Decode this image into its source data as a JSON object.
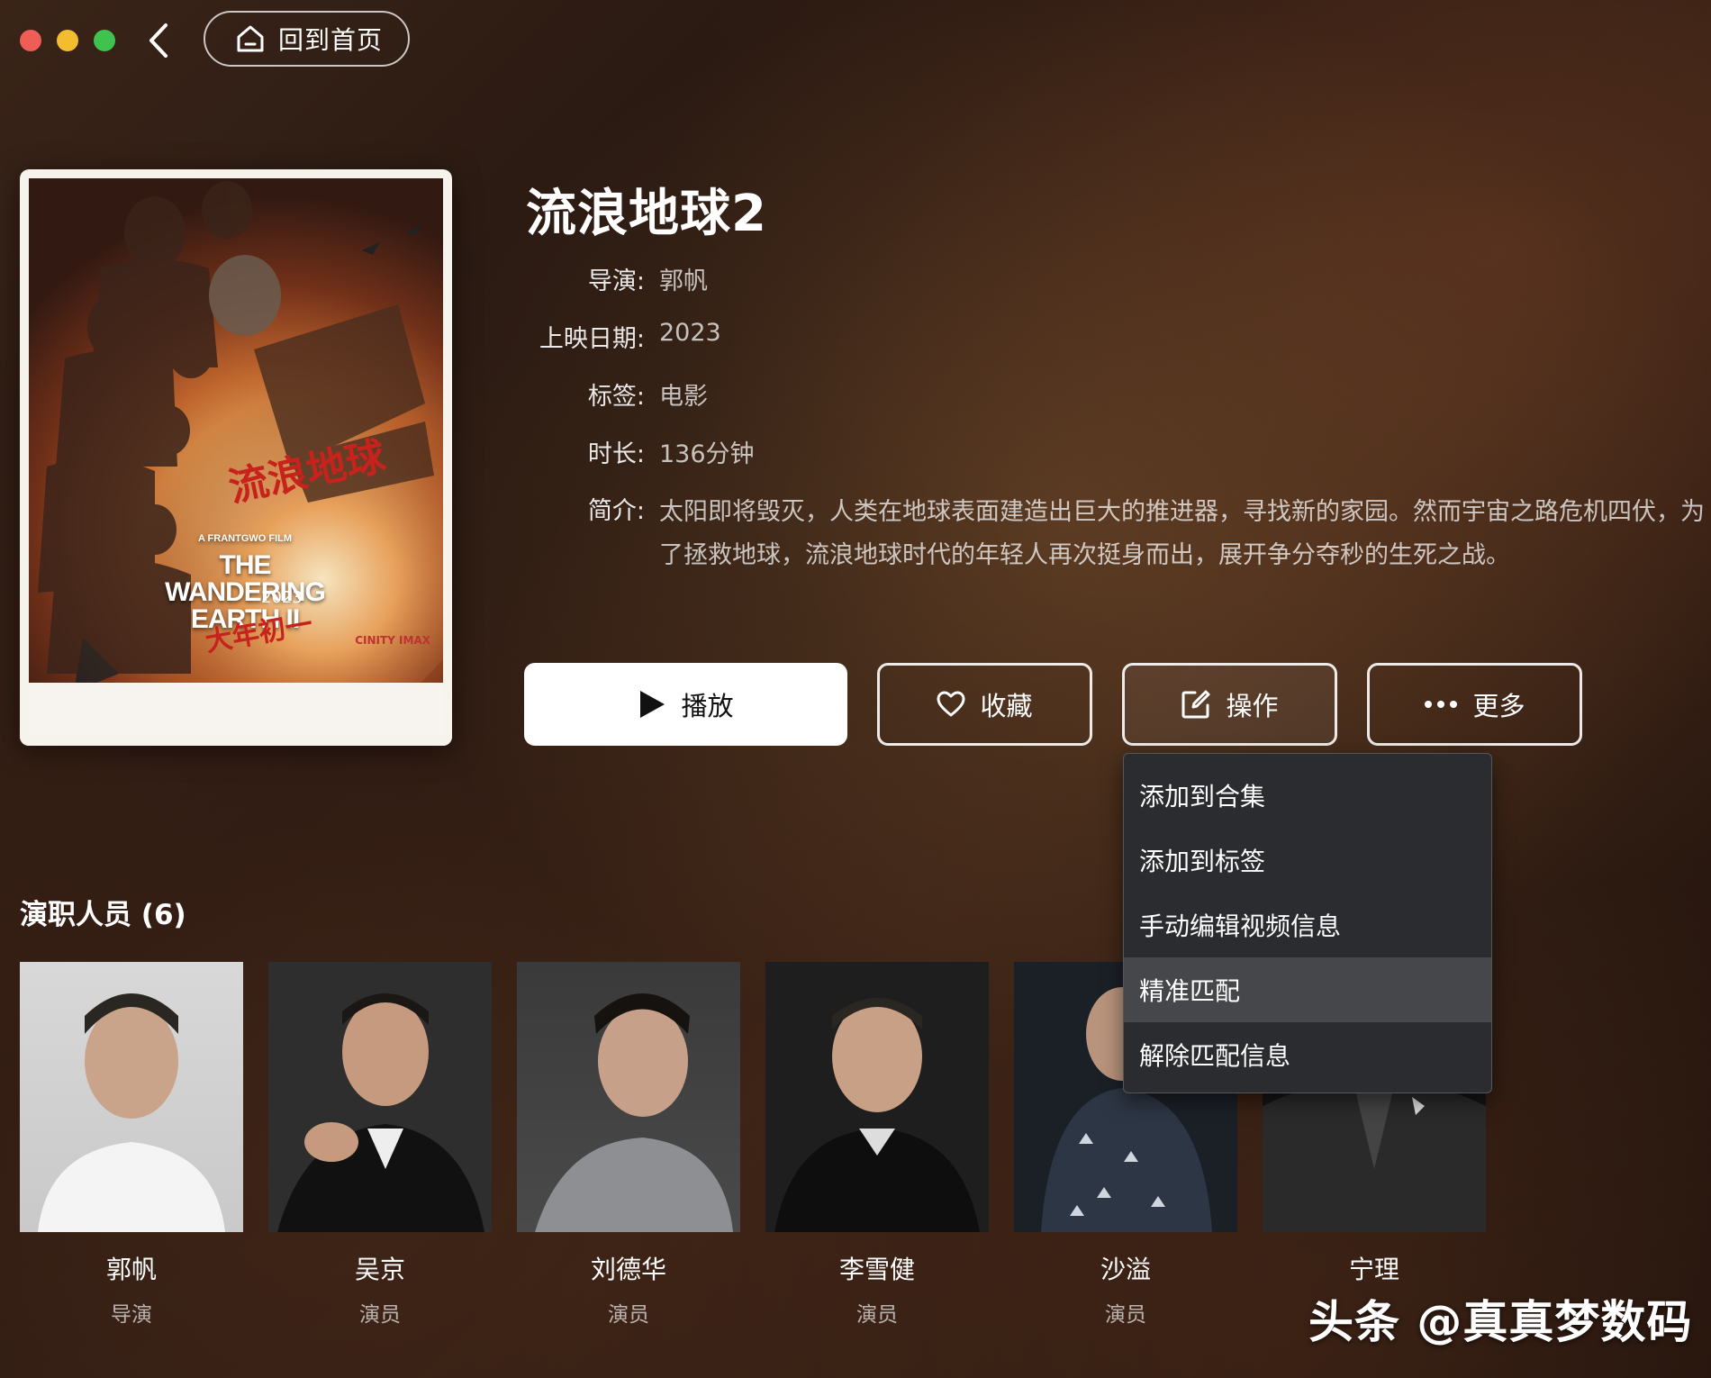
{
  "window": {
    "controls": [
      "close",
      "minimize",
      "maximize"
    ]
  },
  "nav": {
    "back_icon": "chevron-left-icon",
    "home_label": "回到首页",
    "home_icon": "home-icon"
  },
  "poster": {
    "title_cn": "流浪地球",
    "presenter": "A FRANTGWO FILM",
    "title_en": "THE WANDERING EARTH II",
    "year": "2023",
    "tagline": "大年初一",
    "imax": "CINITY IMAX"
  },
  "movie": {
    "title": "流浪地球2",
    "director_label": "导演:",
    "director": "郭帆",
    "release_label": "上映日期:",
    "release": "2023",
    "tags_label": "标签:",
    "tags": "电影",
    "duration_label": "时长:",
    "duration": "136分钟",
    "synopsis_label": "简介:",
    "synopsis": "太阳即将毁灭，人类在地球表面建造出巨大的推进器，寻找新的家园。然而宇宙之路危机四伏，为了拯救地球，流浪地球时代的年轻人再次挺身而出，展开争分夺秒的生死之战。"
  },
  "actions": {
    "play": "播放",
    "favorite": "收藏",
    "operate": "操作",
    "more": "更多"
  },
  "menu": {
    "items": [
      "添加到合集",
      "添加到标签",
      "手动编辑视频信息",
      "精准匹配",
      "解除匹配信息"
    ],
    "active_index": 3
  },
  "cast": {
    "heading": "演职人员 (6)",
    "people": [
      {
        "name": "郭帆",
        "role": "导演"
      },
      {
        "name": "吴京",
        "role": "演员"
      },
      {
        "name": "刘德华",
        "role": "演员"
      },
      {
        "name": "李雪健",
        "role": "演员"
      },
      {
        "name": "沙溢",
        "role": "演员"
      },
      {
        "name": "宁理",
        "role": ""
      }
    ]
  },
  "watermark": "头条 @真真梦数码",
  "colors": {
    "close": "#ee5e56",
    "minimize": "#f4bc2f",
    "maximize": "#3fc24e",
    "menu_bg": "#2b2c2f",
    "menu_active": "#46474b"
  }
}
